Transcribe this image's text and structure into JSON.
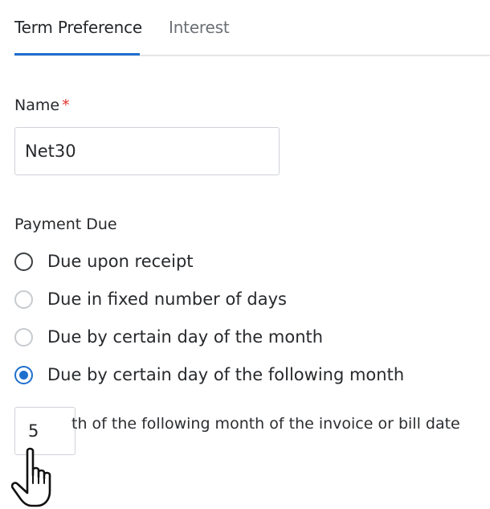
{
  "tabs": [
    {
      "label": "Term Preference",
      "active": true
    },
    {
      "label": "Interest",
      "active": false
    }
  ],
  "form": {
    "name_label": "Name",
    "required_marker": "*",
    "name_value": "Net30",
    "payment_due_label": "Payment Due",
    "options": [
      {
        "label": "Due upon receipt",
        "checked": false
      },
      {
        "label": "Due in fixed number of days",
        "checked": false
      },
      {
        "label": "Due by certain day of the month",
        "checked": false
      },
      {
        "label": "Due by certain day of the following month",
        "checked": true
      }
    ],
    "day_value": "5",
    "day_suffix": "th of the following month of the invoice or bill date"
  },
  "colors": {
    "accent": "#1f6fcf",
    "required": "#e0332b",
    "border": "#cfd3d8"
  },
  "icons": {
    "cursor": "hand-pointer-icon"
  }
}
